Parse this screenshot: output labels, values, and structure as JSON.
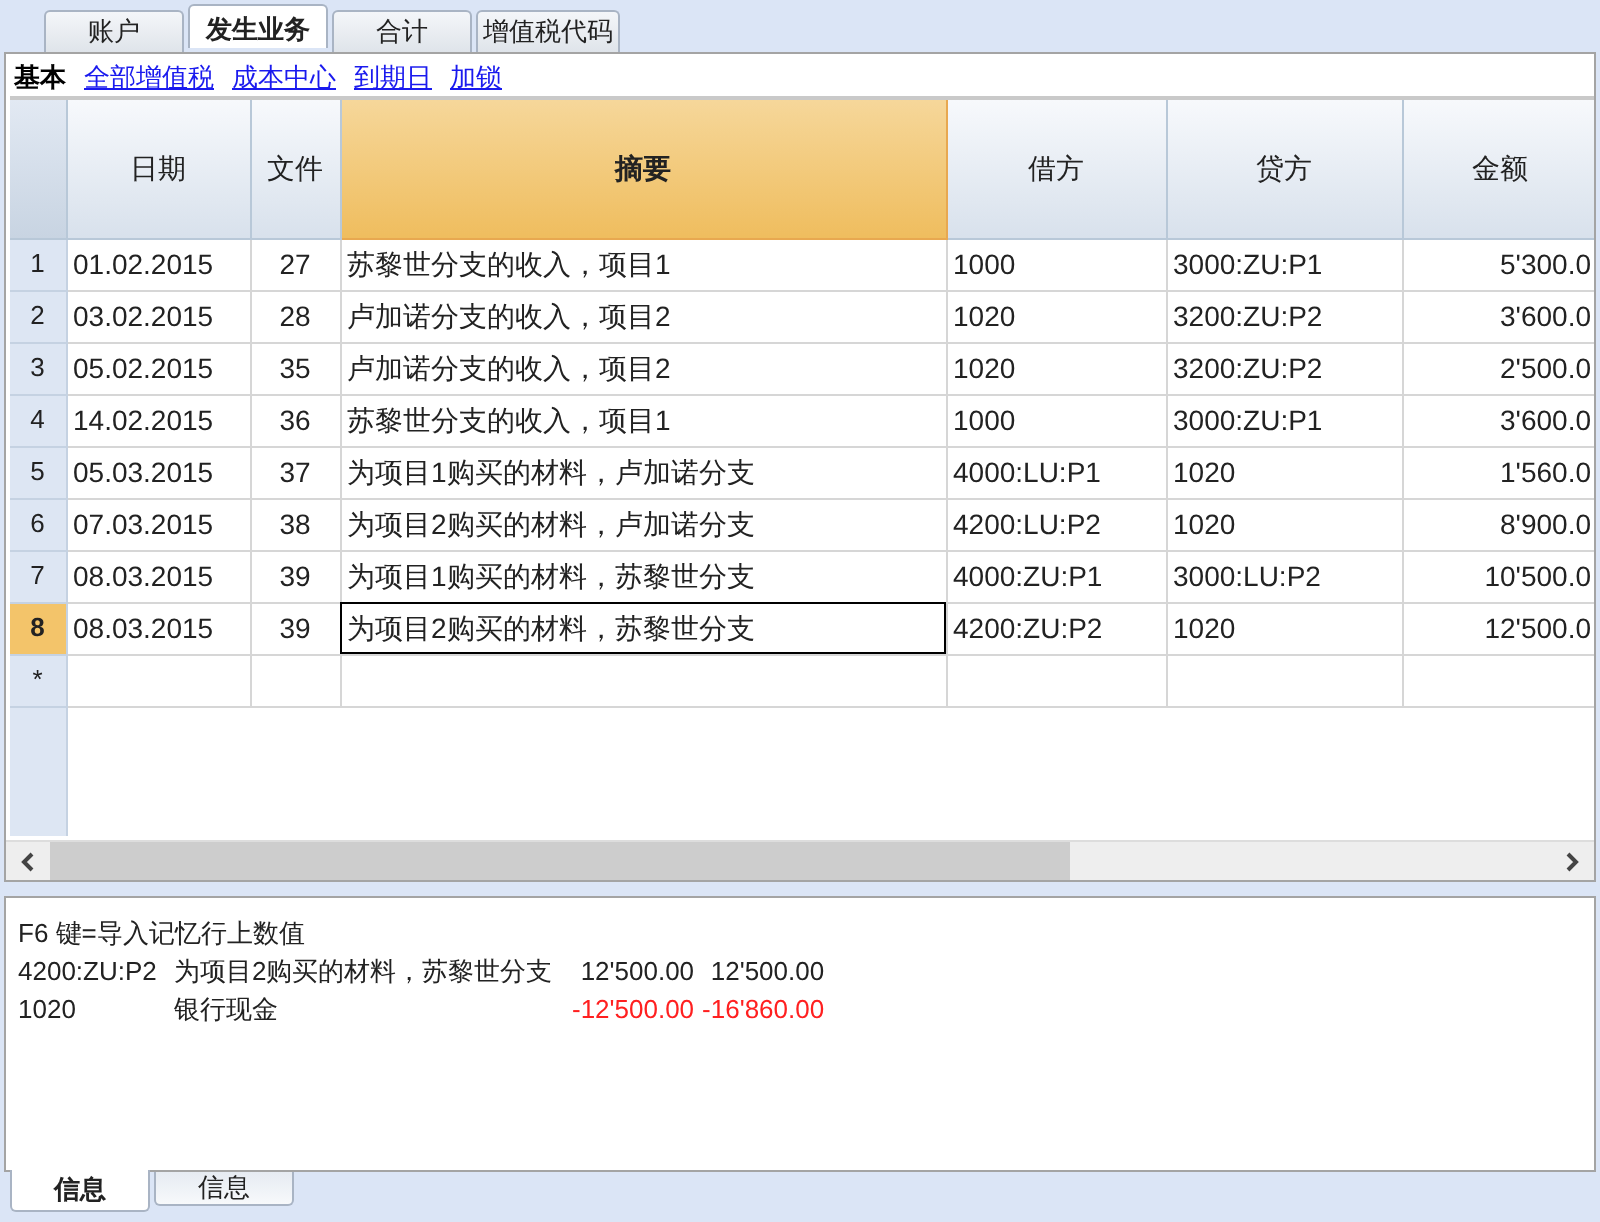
{
  "tabs": [
    {
      "label": "账户",
      "selected": false
    },
    {
      "label": "发生业务",
      "selected": true
    },
    {
      "label": "合计",
      "selected": false
    },
    {
      "label": "增值税代码",
      "selected": false
    }
  ],
  "view_tabs": [
    {
      "label": "基本",
      "selected": true
    },
    {
      "label": "全部增值税",
      "selected": false
    },
    {
      "label": "成本中心",
      "selected": false
    },
    {
      "label": "到期日",
      "selected": false
    },
    {
      "label": "加锁",
      "selected": false
    }
  ],
  "table": {
    "columns": [
      {
        "label": "日期",
        "selected": false
      },
      {
        "label": "文件",
        "selected": false
      },
      {
        "label": "摘要",
        "selected": true
      },
      {
        "label": "借方",
        "selected": false
      },
      {
        "label": "贷方",
        "selected": false
      },
      {
        "label": "金额",
        "selected": false
      }
    ],
    "rows": [
      {
        "number": "1",
        "date": "01.02.2015",
        "doc": "27",
        "description": "苏黎世分支的收入，项目1",
        "debit": "1000",
        "credit": "3000:ZU:P1",
        "amount": "5'300.0",
        "selected": false
      },
      {
        "number": "2",
        "date": "03.02.2015",
        "doc": "28",
        "description": "卢加诺分支的收入，项目2",
        "debit": "1020",
        "credit": "3200:ZU:P2",
        "amount": "3'600.0",
        "selected": false
      },
      {
        "number": "3",
        "date": "05.02.2015",
        "doc": "35",
        "description": "卢加诺分支的收入，项目2",
        "debit": "1020",
        "credit": "3200:ZU:P2",
        "amount": "2'500.0",
        "selected": false
      },
      {
        "number": "4",
        "date": "14.02.2015",
        "doc": "36",
        "description": "苏黎世分支的收入，项目1",
        "debit": "1000",
        "credit": "3000:ZU:P1",
        "amount": "3'600.0",
        "selected": false
      },
      {
        "number": "5",
        "date": "05.03.2015",
        "doc": "37",
        "description": "为项目1购买的材料，卢加诺分支",
        "debit": "4000:LU:P1",
        "credit": "1020",
        "amount": "1'560.0",
        "selected": false
      },
      {
        "number": "6",
        "date": "07.03.2015",
        "doc": "38",
        "description": "为项目2购买的材料，卢加诺分支",
        "debit": "4200:LU:P2",
        "credit": "1020",
        "amount": "8'900.0",
        "selected": false
      },
      {
        "number": "7",
        "date": "08.03.2015",
        "doc": "39",
        "description": "为项目1购买的材料，苏黎世分支",
        "debit": "4000:ZU:P1",
        "credit": "3000:LU:P2",
        "amount": "10'500.0",
        "selected": false
      },
      {
        "number": "8",
        "date": "08.03.2015",
        "doc": "39",
        "description": "为项目2购买的材料，苏黎世分支",
        "debit": "4200:ZU:P2",
        "credit": "1020",
        "amount": "12'500.0",
        "selected": true
      }
    ],
    "new_row_marker": "*"
  },
  "info_panel": {
    "hint": "F6 键=导入记忆行上数值",
    "entries": [
      {
        "account": "4200:ZU:P2",
        "description": "为项目2购买的材料，苏黎世分支",
        "amount": "12'500.00",
        "balance": "12'500.00",
        "negative": false
      },
      {
        "account": "1020",
        "description": "银行现金",
        "amount": "-12'500.00",
        "balance": "-16'860.00",
        "negative": true
      }
    ]
  },
  "bottom_tabs": [
    {
      "label": "信息",
      "selected": true
    },
    {
      "label": "信息",
      "selected": false
    }
  ]
}
